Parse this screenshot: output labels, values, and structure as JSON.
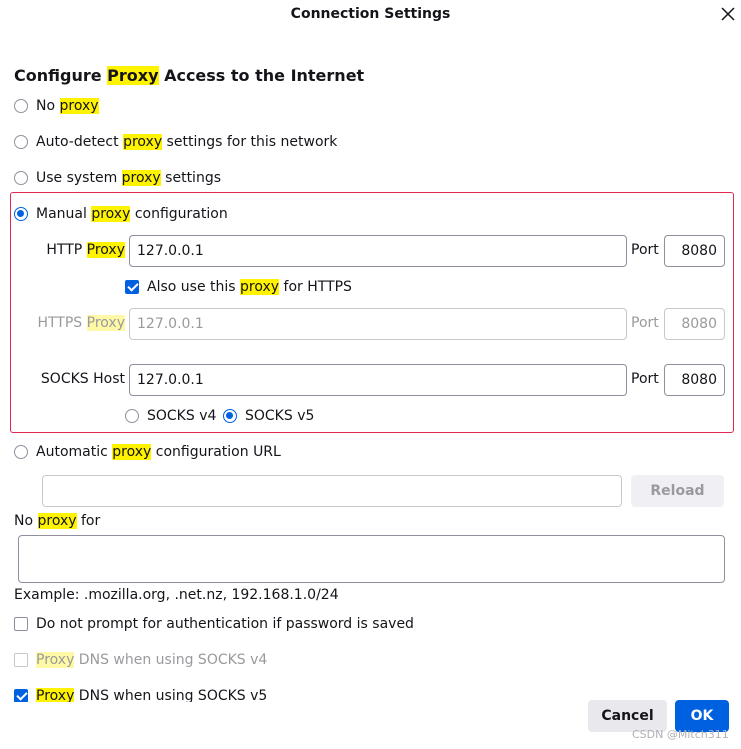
{
  "dialog": {
    "title": "Connection Settings",
    "close_icon": "close-icon"
  },
  "heading": {
    "pre": "Configure ",
    "hl": "Proxy",
    "post": " Access to the Internet"
  },
  "options": {
    "no_proxy": {
      "pre": "No ",
      "hl": "proxy",
      "post": ""
    },
    "auto_detect": {
      "pre": "Auto-detect ",
      "hl": "proxy",
      "post": " settings for this network"
    },
    "system": {
      "pre": "Use system ",
      "hl": "proxy",
      "post": " settings"
    },
    "manual": {
      "pre": "Manual ",
      "hl": "proxy",
      "post": " configuration",
      "selected": true
    },
    "auto_url": {
      "pre": "Automatic ",
      "hl": "proxy",
      "post": " configuration URL"
    }
  },
  "manual": {
    "http": {
      "label_pre": "HTTP ",
      "label_hl": "Proxy",
      "value": "127.0.0.1",
      "port_label": "Port",
      "port": "8080"
    },
    "also_https": {
      "pre": "Also use this ",
      "hl": "proxy",
      "post": " for HTTPS",
      "checked": true
    },
    "https": {
      "label_pre": "HTTPS ",
      "label_hl": "Proxy",
      "value": "127.0.0.1",
      "port_label": "Port",
      "port": "8080"
    },
    "socks": {
      "label": "SOCKS Host",
      "value": "127.0.0.1",
      "port_label": "Port",
      "port": "8080"
    },
    "socks_v4": "SOCKS v4",
    "socks_v5": "SOCKS v5",
    "socks_selected": "v5"
  },
  "auto_url": {
    "value": "",
    "reload_label": "Reload"
  },
  "no_proxy_for": {
    "pre": "No ",
    "hl": "proxy",
    "post": " for",
    "value": "",
    "example": "Example: .mozilla.org, .net.nz, 192.168.1.0/24"
  },
  "checkboxes": {
    "no_prompt": {
      "label": "Do not prompt for authentication if password is saved",
      "checked": false
    },
    "dns_v4": {
      "hl": "Proxy",
      "post": " DNS when using SOCKS v4",
      "checked": false,
      "disabled": true
    },
    "dns_v5": {
      "hl": "Proxy",
      "post": " DNS when using SOCKS v5",
      "checked": true
    }
  },
  "buttons": {
    "cancel": "Cancel",
    "ok": "OK"
  },
  "watermark": "CSDN @Mitch311",
  "colors": {
    "accent": "#0061e0",
    "highlight": "#fff300",
    "red_outline": "#e22850"
  }
}
